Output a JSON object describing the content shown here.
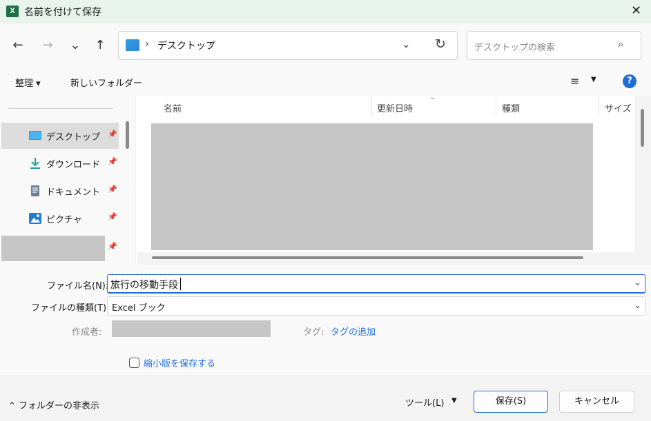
{
  "window": {
    "title": "名前を付けて保存",
    "app_icon": "X",
    "close": "✕"
  },
  "nav": {
    "back": "←",
    "forward": "→",
    "recent": "⌄",
    "up": "↑",
    "address": {
      "separator": "›",
      "path": "デスクトップ",
      "dropdown": "⌄",
      "refresh": "↻"
    },
    "search_placeholder": "デスクトップの検索",
    "search_icon": "⌕"
  },
  "toolbar": {
    "organize": "整理 ▾",
    "new_folder": "新しいフォルダー",
    "view_icon": "≡",
    "view_arrow": "▼",
    "help": "?"
  },
  "sidebar": {
    "items": [
      {
        "label": "デスクトップ",
        "icon": "desktop-icon"
      },
      {
        "label": "ダウンロード",
        "icon": "download-icon"
      },
      {
        "label": "ドキュメント",
        "icon": "document-icon"
      },
      {
        "label": "ピクチャ",
        "icon": "picture-icon"
      }
    ],
    "pin": "📌"
  },
  "filelist": {
    "columns": [
      "名前",
      "更新日時",
      "種類",
      "サイズ"
    ],
    "sort_indicator": "⌄"
  },
  "form": {
    "filename_label": "ファイル名(N):",
    "filename_value": "旅行の移動手段",
    "filetype_label": "ファイルの種類(T):",
    "filetype_value": "Excel ブック",
    "dropdown": "⌄",
    "author_label": "作成者:",
    "tag_label": "タグ:",
    "tag_link": "タグの追加",
    "thumbnail_label": "縮小版を保存する"
  },
  "footer": {
    "hide_folders": "⌃ フォルダーの非表示",
    "tools": "ツール(L)",
    "tools_arrow": "▼",
    "save": "保存(S)",
    "cancel": "キャンセル"
  },
  "colors": {
    "accent": "#1f6ed8",
    "excel_green": "#1e7145",
    "redacted": "#c6c6c6"
  }
}
